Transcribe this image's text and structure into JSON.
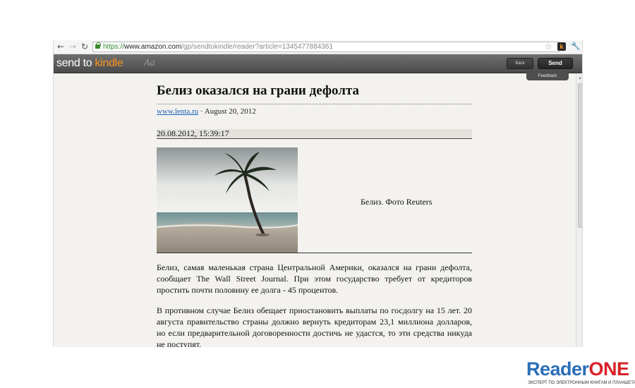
{
  "browser": {
    "url_https": "https://",
    "url_host": "www.amazon.com",
    "url_path": "/gp/sendtokindle/reader?article=1345477884361",
    "extension_badge": "k"
  },
  "toolbar": {
    "logo_part1": "send to ",
    "logo_part2": "kindle",
    "font_button": "Aa",
    "back_label": "Back",
    "send_label": "Send",
    "feedback_label": "Feedback",
    "accent_color": "#f7941d"
  },
  "article": {
    "title": "Белиз оказался на грани дефолта",
    "source": "www.lenta.ru",
    "separator": "·",
    "date": "August 20, 2012",
    "timestamp": "20.08.2012, 15:39:17",
    "image_caption": "Белиз. Фото Reuters",
    "paragraphs": [
      "Белиз, самая маленькая страна Центральной Америки, оказался на грани дефолта, сообщает The Wall Street Journal. При этом государство требует от кредиторов простить почти половину ее долга - 45 процентов.",
      "В противном случае Белиз обещает приостановить выплаты по госдолгу на 15 лет. 20 августа правительство страны должно вернуть кредиторам 23,1 миллиона долларов, но если предварительной договоренности достичь не удастся, то эти средства никуда не поступят."
    ]
  },
  "watermark": {
    "brand_part1": "Reader",
    "brand_part2": "ONE",
    "tagline": "ЭКСПЕРТ ПО ЭЛЕКТРОННЫМ КНИГАМ И ПЛАНШЕТАМ"
  }
}
